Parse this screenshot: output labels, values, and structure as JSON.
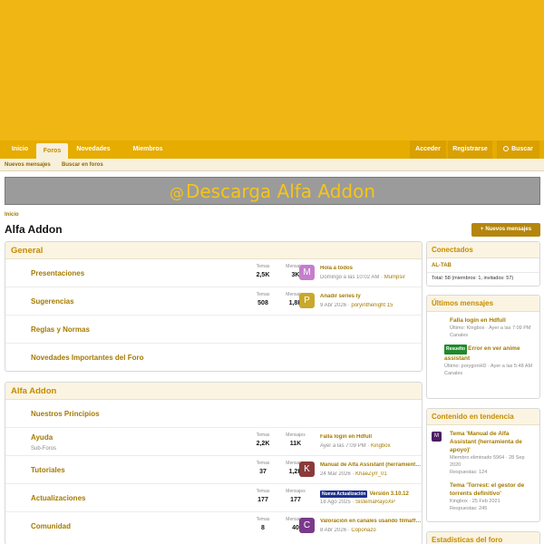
{
  "nav": {
    "tabs": [
      "Inicio",
      "Foros",
      "Novedades",
      "Miembros"
    ],
    "login": "Acceder",
    "register": "Registrarse",
    "search": "Buscar"
  },
  "subnav": [
    "Nuevos mensajes",
    "Buscar en foros"
  ],
  "banner": {
    "at": "@",
    "text": "Descarga Alfa Addon"
  },
  "breadcrumb": "Inicio",
  "page_title": "Alfa Addon",
  "new_posts_button": "Nuevos mensajes",
  "labels": {
    "threads": "Temas",
    "messages": "Mensajes"
  },
  "general": {
    "title": "General",
    "nodes": [
      {
        "title": "Presentaciones",
        "threads": "2,5K",
        "messages": "3K",
        "avatar": "M",
        "avatar_color": "#c57fcb",
        "last_title": "Hola a todos",
        "last_date": "Domingo a las 10:02 AM",
        "last_user": "Mumpsir"
      },
      {
        "title": "Sugerencias",
        "threads": "508",
        "messages": "1,8K",
        "avatar": "P",
        "avatar_color": "#c9a82a",
        "last_title": "Añadir series ly",
        "last_date": "9 Abr 2026",
        "last_user": "poryinthenight 15"
      },
      {
        "title": "Reglas y Normas"
      },
      {
        "title": "Novedades Importantes del Foro"
      }
    ]
  },
  "alfa": {
    "title": "Alfa Addon",
    "nodes": [
      {
        "title": "Nuestros Principios"
      },
      {
        "title": "Ayuda",
        "sub": "Sub-Foros",
        "threads": "2,2K",
        "messages": "11K",
        "last_title": "Falla login en Hdfull",
        "last_date": "Ayer a las 7:09 PM",
        "last_user": "Kingbox"
      },
      {
        "title": "Tutoriales",
        "threads": "37",
        "messages": "1,2K",
        "avatar": "K",
        "avatar_color": "#8b3a3a",
        "last_title": "Manual de Alfa Assistant (herramienta de apoyo)",
        "last_date": "24 Mar 2026",
        "last_user": "KhaeZyrr_01"
      },
      {
        "title": "Actualizaciones",
        "threads": "177",
        "messages": "177",
        "badge": "Nueva Actualización",
        "last_title": "Versión 3.10.12",
        "last_date": "18 Ago 2025",
        "last_user": "SistemaRayoXP"
      },
      {
        "title": "Comunidad",
        "threads": "8",
        "messages": "40",
        "avatar": "C",
        "avatar_color": "#7a3a8a",
        "last_title": "Valoración en canales usando filmaffinity",
        "last_date": "8 Abr 2026",
        "last_user": "Coponazo"
      }
    ]
  },
  "online": {
    "title": "Conectados",
    "users": "AL-TAB",
    "total": "Total: 58 (miembros: 1, invitados: 57)"
  },
  "latest": {
    "title": "Últimos mensajes",
    "items": [
      {
        "title": "Falla login en Hdfull",
        "meta": "Último: Kingbox · Ayer a las 7:09 PM",
        "forum": "Canales"
      },
      {
        "prefix": "Resuelto",
        "title": "Error en ver anime assistant",
        "meta": "Último: porygonHD · Ayer a las 5:48 AM",
        "forum": "Canales"
      }
    ]
  },
  "trending": {
    "title": "Contenido en tendencia",
    "items": [
      {
        "avatar": "M",
        "title": "Tema 'Manual de Alfa Assistant (herramienta de apoyo)'",
        "meta": "Miembro eliminado 5964 · 28 Sep 2020",
        "replies": "Respuestas: 124"
      },
      {
        "title": "Tema 'Torrest: el gestor de torrents definitivo'",
        "meta": "Kingbox · 25 Feb 2021",
        "replies": "Respuestas: 245"
      }
    ]
  },
  "stats": {
    "title": "Estadísticas del foro"
  },
  "colors": {
    "brand": "#efb614",
    "nav": "#e6ac00",
    "link": "#a57a00"
  }
}
